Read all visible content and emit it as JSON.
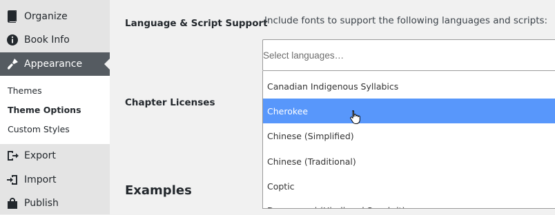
{
  "sidebar": {
    "items": [
      {
        "label": "Organize",
        "icon": "book-icon"
      },
      {
        "label": "Book Info",
        "icon": "info-icon"
      },
      {
        "label": "Appearance",
        "icon": "paintbrush-icon"
      },
      {
        "label": "Export",
        "icon": "export-icon"
      },
      {
        "label": "Import",
        "icon": "import-icon"
      },
      {
        "label": "Publish",
        "icon": "cart-icon"
      }
    ],
    "submenu": [
      {
        "label": "Themes"
      },
      {
        "label": "Theme Options"
      },
      {
        "label": "Custom Styles"
      }
    ]
  },
  "main": {
    "language_label": "Language & Script Support",
    "language_description": "Include fonts to support the following languages and scripts:",
    "select_placeholder": "Select languages…",
    "licenses_label": "Chapter Licenses",
    "examples_heading": "Examples",
    "options": [
      "Canadian Indigenous Syllabics",
      "Cherokee",
      "Chinese (Simplified)",
      "Chinese (Traditional)",
      "Coptic",
      "Devanagari (Hindi and Sanskrit)"
    ],
    "highlighted_option": "Cherokee"
  },
  "colors": {
    "sidebar_bg": "#e4e4e4",
    "active_menu_bg": "#555b61",
    "highlight": "#5897fb",
    "page_bg": "#f1f1f1"
  }
}
